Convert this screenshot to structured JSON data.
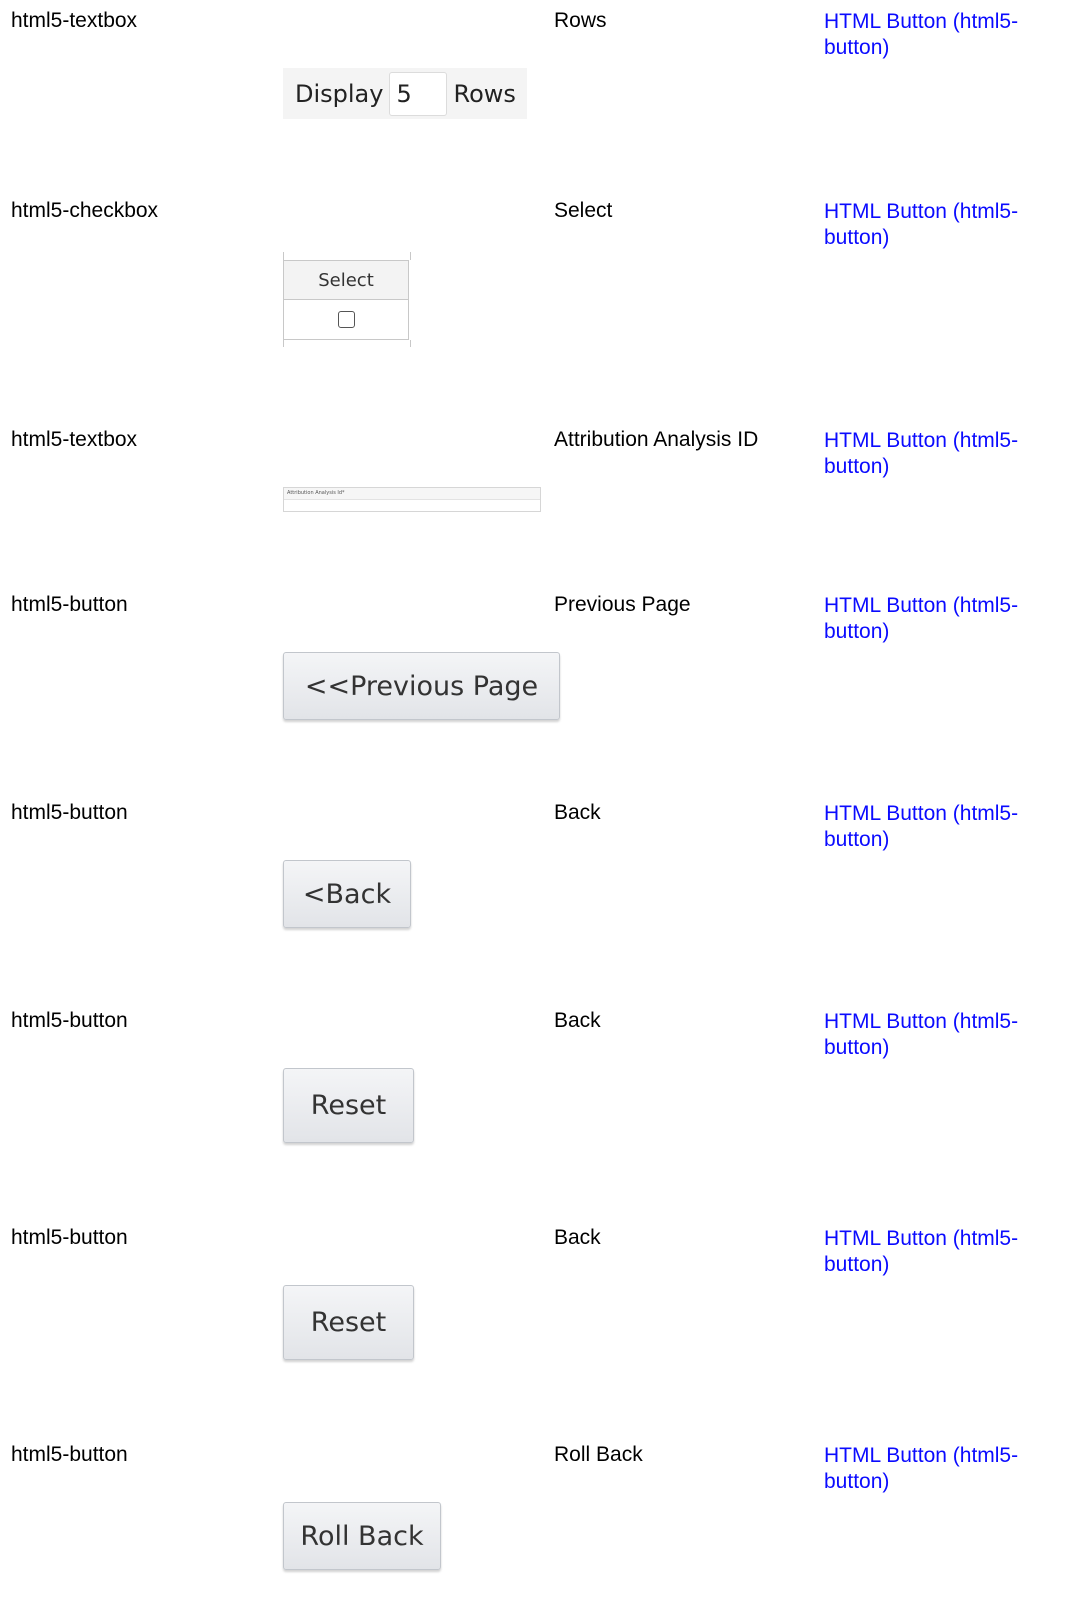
{
  "rows": [
    {
      "type": "html5-textbox",
      "label": "Rows",
      "link": "HTML Button (html5-button)",
      "widget": {
        "text_before": "Display",
        "value": "5",
        "text_after": "Rows"
      }
    },
    {
      "type": "html5-checkbox",
      "label": "Select",
      "link": "HTML Button (html5-button)",
      "widget": {
        "header": "Select",
        "checked": false
      }
    },
    {
      "type": "html5-textbox",
      "label": "Attribution Analysis ID",
      "link": "HTML Button (html5-button)",
      "widget": {
        "field_label": "Attribution Analysis Id*"
      }
    },
    {
      "type": "html5-button",
      "label": "Previous Page",
      "link": "HTML Button (html5-button)",
      "widget": {
        "button_text": "<<Previous Page"
      }
    },
    {
      "type": "html5-button",
      "label": "Back",
      "link": "HTML Button (html5-button)",
      "widget": {
        "button_text": "<Back"
      }
    },
    {
      "type": "html5-button",
      "label": "Back",
      "link": "HTML Button (html5-button)",
      "widget": {
        "button_text": "Reset"
      }
    },
    {
      "type": "html5-button",
      "label": "Back",
      "link": "HTML Button (html5-button)",
      "widget": {
        "button_text": "Reset"
      }
    },
    {
      "type": "html5-button",
      "label": "Roll Back",
      "link": "HTML Button (html5-button)",
      "widget": {
        "button_text": "Roll Back"
      }
    }
  ],
  "colors": {
    "link": "#0b0bff",
    "text": "#000000",
    "button_bg": "#e8eaed"
  }
}
